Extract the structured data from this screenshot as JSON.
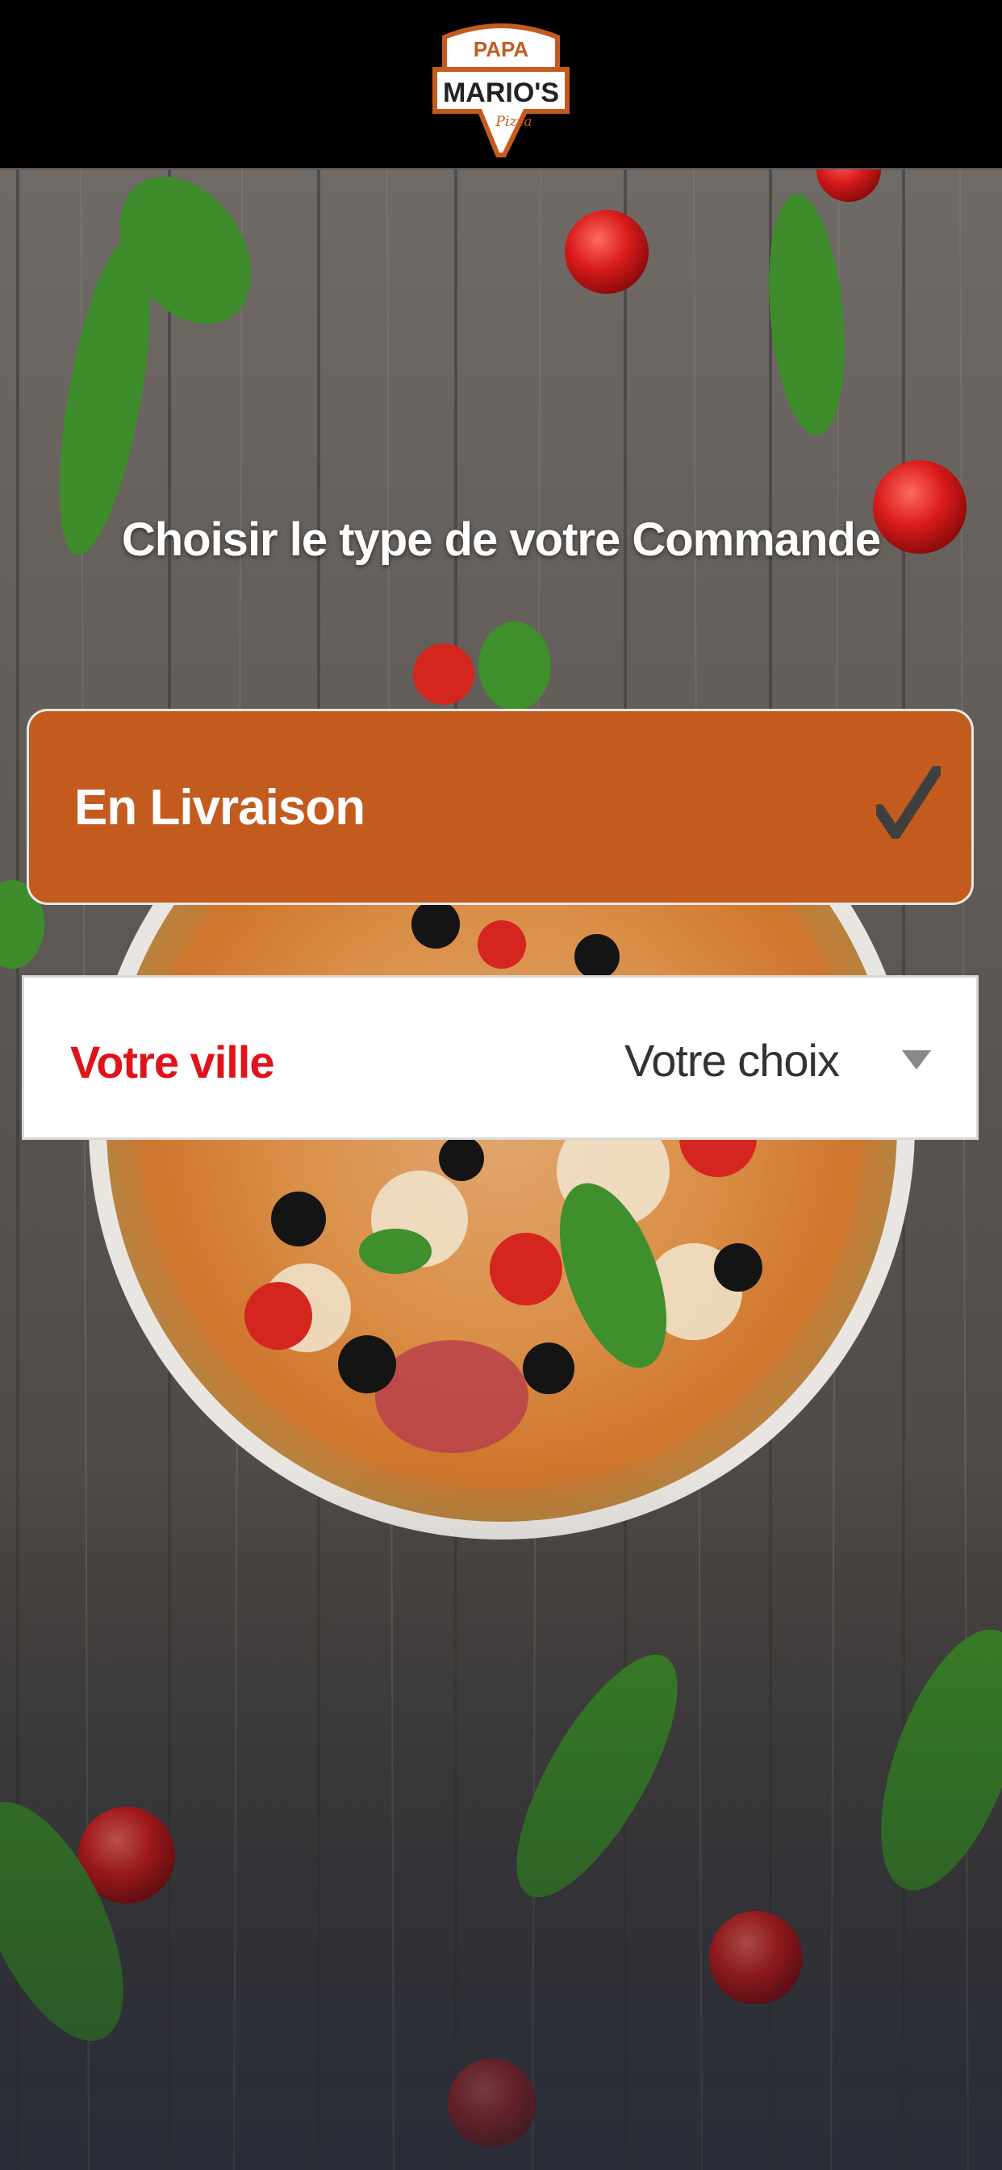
{
  "header": {
    "logo_top": "PAPA",
    "logo_main": "MARIO'S",
    "logo_sub": "Pizza"
  },
  "title": "Choisir le type de votre Commande",
  "order_type": {
    "label": "En Livraison",
    "selected": true,
    "icon": "check-icon"
  },
  "city": {
    "label": "Votre ville",
    "value": "Votre choix",
    "icon": "dropdown-arrow-icon"
  },
  "colors": {
    "accent": "#c45b1e",
    "city_label": "#e0131a",
    "header_bg": "#000000",
    "background": "#5f5a56"
  }
}
